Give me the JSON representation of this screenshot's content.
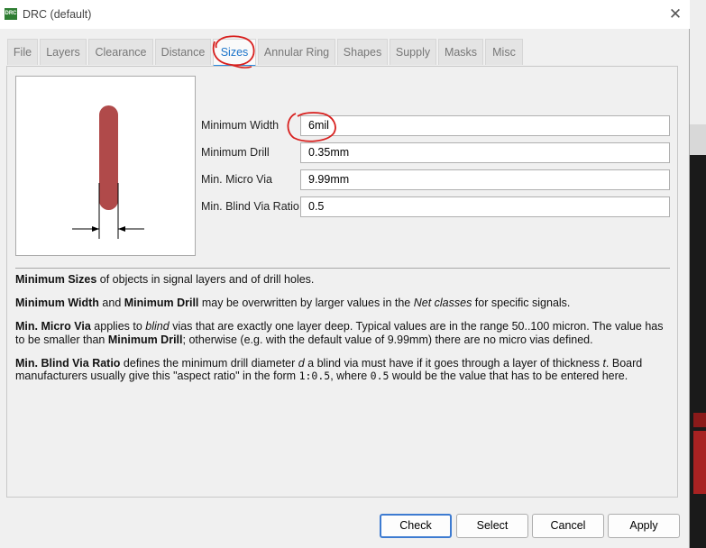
{
  "window": {
    "title": "DRC (default)",
    "icon_label": "DRC"
  },
  "tabs": [
    {
      "label": "File"
    },
    {
      "label": "Layers"
    },
    {
      "label": "Clearance"
    },
    {
      "label": "Distance"
    },
    {
      "label": "Sizes",
      "active": true
    },
    {
      "label": "Annular Ring"
    },
    {
      "label": "Shapes"
    },
    {
      "label": "Supply"
    },
    {
      "label": "Masks"
    },
    {
      "label": "Misc"
    }
  ],
  "fields": [
    {
      "label": "Minimum Width",
      "value": "6mil"
    },
    {
      "label": "Minimum Drill",
      "value": "0.35mm"
    },
    {
      "label": "Min. Micro Via",
      "value": "9.99mm"
    },
    {
      "label": "Min. Blind Via Ratio",
      "value": "0.5"
    }
  ],
  "help": {
    "p1": {
      "b1": "Minimum Sizes",
      "t1": " of objects in signal layers and of drill holes."
    },
    "p2": {
      "b1": "Minimum Width",
      "t1": " and ",
      "b2": "Minimum Drill",
      "t2": " may be overwritten by larger values in the ",
      "i1": "Net classes",
      "t3": " for specific signals."
    },
    "p3": {
      "b1": "Min. Micro Via",
      "t1": " applies to ",
      "i1": "blind",
      "t2": " vias that are exactly one layer deep. Typical values are in the range 50..100 micron. The value has to be smaller than ",
      "b2": "Minimum Drill",
      "t3": "; otherwise (e.g. with the default value of 9.99mm) there are no micro vias defined."
    },
    "p4": {
      "b1": "Min. Blind Via Ratio",
      "t1": " defines the minimum drill diameter ",
      "i1": "d",
      "t2": " a blind via must have if it goes through a layer of thickness ",
      "i2": "t",
      "t3": ". Board manufacturers usually give this \"aspect ratio\" in the form ",
      "c1": "1:0.5",
      "t4": ", where ",
      "c2": "0.5",
      "t5": " would be the value that has to be entered here."
    }
  },
  "buttons": {
    "check": "Check",
    "select": "Select",
    "cancel": "Cancel",
    "apply": "Apply"
  },
  "colors": {
    "accent": "#2b8ce0",
    "trace": "#b04a4a",
    "annotation": "#d8201e"
  }
}
